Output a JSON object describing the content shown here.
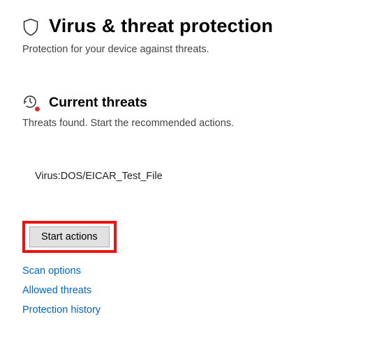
{
  "header": {
    "title": "Virus & threat protection",
    "subtitle": "Protection for your device against threats."
  },
  "section": {
    "title": "Current threats",
    "subtitle": "Threats found. Start the recommended actions.",
    "threats": [
      {
        "name": "Virus:DOS/EICAR_Test_File"
      }
    ],
    "start_label": "Start actions"
  },
  "links": {
    "scan_options": "Scan options",
    "allowed_threats": "Allowed threats",
    "protection_history": "Protection history"
  },
  "icons": {
    "shield": "shield-icon",
    "history": "history-icon"
  },
  "accent_red": "#d13438"
}
